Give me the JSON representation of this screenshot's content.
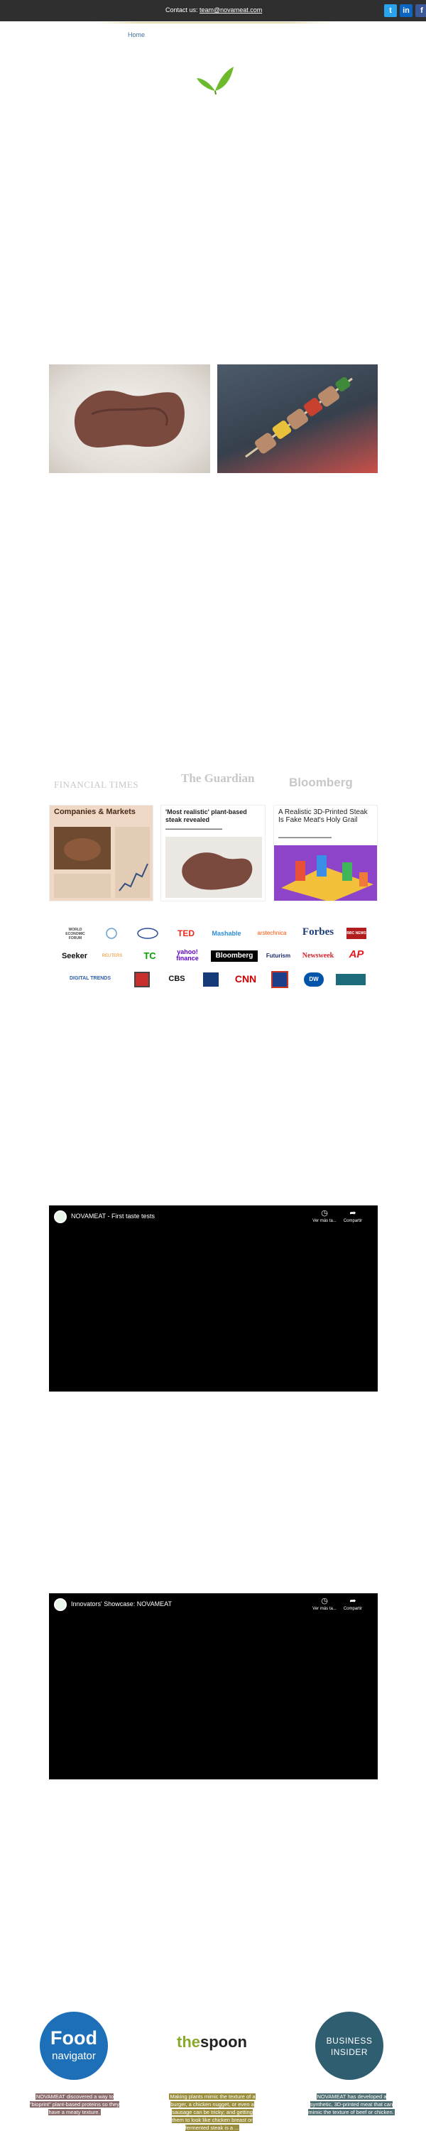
{
  "topbar": {
    "contact_prefix": "Contact us: ",
    "contact_email": "team@novameat.com",
    "social": [
      "twitter-icon",
      "linkedin-icon",
      "facebook-icon"
    ]
  },
  "nav": {
    "home_label": "Home"
  },
  "press": {
    "outlets": [
      "FINANCIAL TIMES",
      "The Guardian",
      "Bloomberg"
    ],
    "articles": [
      {
        "headline": "Companies & Markets",
        "sub": ""
      },
      {
        "headline": "'Most realistic' plant-based steak revealed",
        "sub": ""
      },
      {
        "headline": "A Realistic 3D-Printed Steak Is Fake Meat's Holy Grail",
        "sub": ""
      }
    ]
  },
  "media_logos": [
    "WORLD ECONOMIC FORUM",
    "",
    "",
    "TED",
    "Mashable",
    "arstechnica",
    "Forbes",
    "BBC NEWS",
    "Seeker",
    "REUTERS",
    "TC",
    "yahoo! finance",
    "Bloomberg",
    "Futurism",
    "Newsweek",
    "AP",
    "DIGITAL TRENDS",
    "",
    "CBS",
    "",
    "CNN",
    "",
    "DW",
    ""
  ],
  "videos": [
    {
      "title": "NOVAMEAT - First taste tests",
      "watch_later": "Ver más ta...",
      "share": "Compartir"
    },
    {
      "title": "Innovators' Showcase: NOVAMEAT",
      "watch_later": "Ver más ta...",
      "share": "Compartir"
    }
  ],
  "features": [
    {
      "logo_l1": "Food",
      "logo_l2": "navigator",
      "quote": "NOVAMEAT discovered a way to \"bioprint\" plant-based proteins so they have a meaty texture."
    },
    {
      "logo_l1": "the",
      "logo_l2": "spoon",
      "quote": "Making plants mimic the texture of a burger, a chicken nugget, or even a sausage can be tricky; and getting them to look like chicken breast or fermented steak is a ..."
    },
    {
      "logo_l1": "BUSINESS",
      "logo_l2": "INSIDER",
      "quote": "NOVAMEAT has developed a synthetic, 3D-printed meat that can mimic the texture of beef or chicken."
    }
  ],
  "colors": {
    "topbar": "#2f2f2f",
    "leaf_green": "#6dbb2c",
    "video_bg": "#000000",
    "food_navigator": "#1d6fb8",
    "business_insider": "#2f5e71"
  }
}
